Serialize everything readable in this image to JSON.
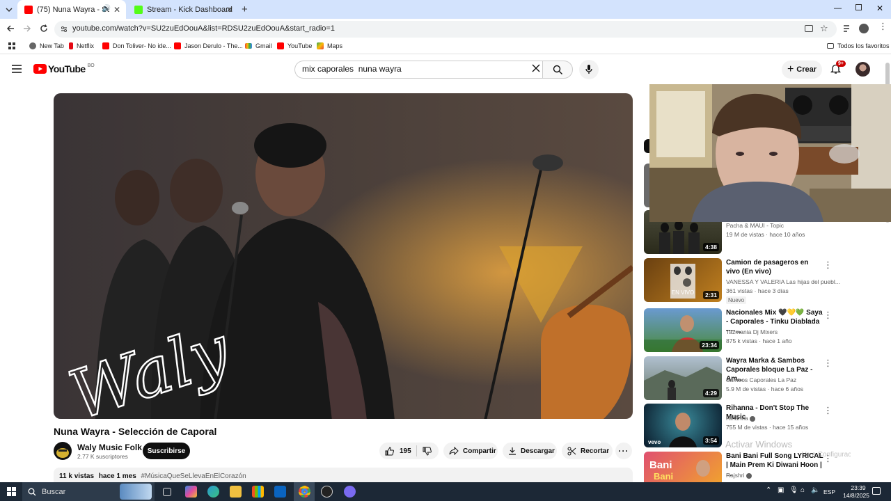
{
  "browser": {
    "tabs": [
      {
        "title": "(75) Nuna Wayra - Selecció",
        "active": true
      },
      {
        "title": "Stream - Kick Dashboard",
        "active": false
      }
    ],
    "url": "youtube.com/watch?v=SU2zuEdOouA&list=RDSU2zuEdOouA&start_radio=1",
    "bookmarks": [
      "New Tab",
      "Netflix",
      "Don Toliver- No ide...",
      "Jason Derulo - The...",
      "Gmail",
      "YouTube",
      "Maps"
    ],
    "all_bookmarks": "Todos los favoritos"
  },
  "youtube": {
    "logo_text": "YouTube",
    "country": "BO",
    "search_value": "mix caporales  nuna wayra",
    "create_label": "Crear",
    "notifications": "9+"
  },
  "video": {
    "title": "Nuna Wayra - Selección de Caporal",
    "watermark": "Waly",
    "channel": "Waly Music Folk",
    "subscribers": "2.77 K suscriptores",
    "subscribe_label": "Suscribirse",
    "likes": "195",
    "share_label": "Compartir",
    "download_label": "Descargar",
    "clip_label": "Recortar",
    "views": "11 k vistas",
    "age": "hace 1 mes",
    "hashtag": "#MúsicaQueSeLlevaEnElCorazón"
  },
  "recommendations": [
    {
      "title": "",
      "channel": "Pacha & MAUI - Topic",
      "views": "19 M de vistas",
      "age": "hace 10 años",
      "duration": "4:38",
      "thumb_color": "#3a3a2a"
    },
    {
      "title": "Camion de pasageros en vivo (En vivo)",
      "channel": "VANESSA Y VALERIA Las hijas del puebl...",
      "views": "361 vistas",
      "age": "hace 3 días",
      "duration": "2:31",
      "badge": "Nuevo",
      "thumb_color": "#8a5a1a"
    },
    {
      "title": "Nacionales Mix 🖤💛💚 Saya - Caporales - Tinku Diablada ----...",
      "channel": "Tazmania Dj Mixers",
      "views": "875 k vistas",
      "age": "hace 1 año",
      "duration": "23:34",
      "thumb_color": "#4a7a3a"
    },
    {
      "title": "Wayra Marka & Sambos Caporales bloque La Paz - Am...",
      "channel": "Sambos Caporales La Paz",
      "views": "5.9 M de vistas",
      "age": "hace 6 años",
      "duration": "4:29",
      "thumb_color": "#5a6a5a"
    },
    {
      "title": "Rihanna - Don't Stop The Music",
      "channel": "Rihanna",
      "views": "755 M de vistas",
      "age": "hace 15 años",
      "duration": "3:54",
      "thumb_color": "#1a3a4a"
    },
    {
      "title": "Bani Bani Full Song LYRICAL | Main Prem Ki Diwani Hoon | ...",
      "channel": "Rajshri",
      "views": "",
      "age": "",
      "duration": "",
      "thumb_color": "#b04060"
    }
  ],
  "windows": {
    "activate_title": "Activar Windows",
    "activate_sub": "Ve a Configuración para activar Windows.",
    "search_label": "Buscar",
    "lang": "ESP",
    "time": "23:39",
    "date": "14/8/2025"
  }
}
